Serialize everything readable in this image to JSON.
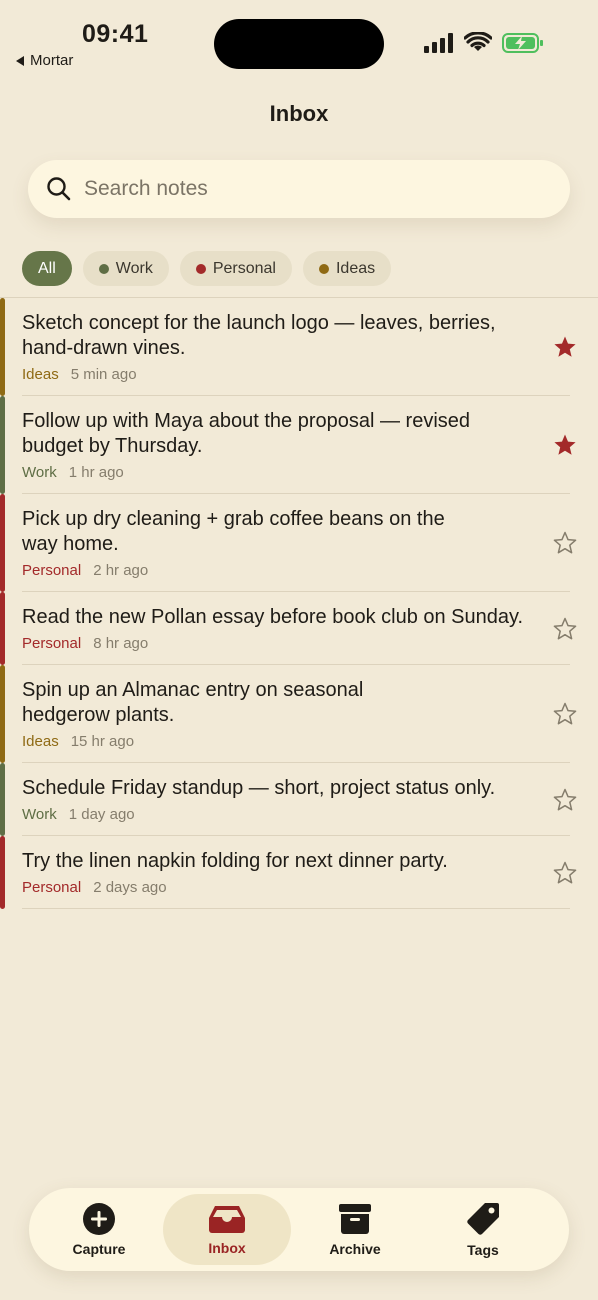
{
  "status_bar": {
    "time": "09:41",
    "back_app": "Mortar"
  },
  "header": {
    "title": "Inbox"
  },
  "search": {
    "placeholder": "Search notes"
  },
  "filters": [
    {
      "label": "All",
      "active": true
    },
    {
      "label": "Work",
      "color": "#5f6e45"
    },
    {
      "label": "Personal",
      "color": "#a32a2a"
    },
    {
      "label": "Ideas",
      "color": "#8f6a14"
    }
  ],
  "notes": [
    {
      "lines": [
        "Sketch concept for the launch logo — leaves, berries,",
        "hand-drawn vines."
      ],
      "tag": "Ideas",
      "time": "5 min ago",
      "starred": true
    },
    {
      "lines": [
        "Follow up with Maya about the proposal — revised",
        "budget by Thursday."
      ],
      "tag": "Work",
      "time": "1 hr ago",
      "starred": true
    },
    {
      "lines": [
        "Pick up dry cleaning + grab coffee beans on the",
        "way home."
      ],
      "tag": "Personal",
      "time": "2 hr ago",
      "starred": false
    },
    {
      "lines": [
        "Read the new Pollan essay before book club on Sunday."
      ],
      "tag": "Personal",
      "time": "8 hr ago",
      "starred": false
    },
    {
      "lines": [
        "Spin up an Almanac entry on seasonal",
        "hedgerow plants."
      ],
      "tag": "Ideas",
      "time": "15 hr ago",
      "starred": false
    },
    {
      "lines": [
        "Schedule Friday standup — short, project status only."
      ],
      "tag": "Work",
      "time": "1 day ago",
      "starred": false
    },
    {
      "lines": [
        "Try the linen napkin folding for next dinner party."
      ],
      "tag": "Personal",
      "time": "2 days ago",
      "starred": false
    }
  ],
  "tag_colors": {
    "Work": "#5f6e45",
    "Personal": "#a32a2a",
    "Ideas": "#8f6a14"
  },
  "colors": {
    "background": "#f2ead7",
    "accent": "#667649",
    "star": "#a32a2a"
  },
  "tabbar": {
    "capture": "Capture",
    "inbox": "Inbox",
    "archive": "Archive",
    "tags": "Tags"
  }
}
